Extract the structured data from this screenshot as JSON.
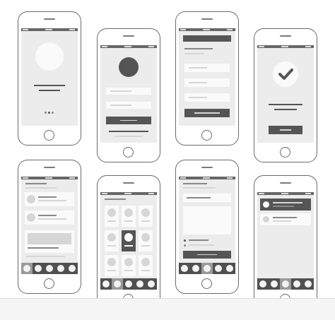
{
  "screens": [
    {
      "id": "splash",
      "description_label": ""
    },
    {
      "id": "login"
    },
    {
      "id": "form"
    },
    {
      "id": "success"
    },
    {
      "id": "feed"
    },
    {
      "id": "grid"
    },
    {
      "id": "compose"
    },
    {
      "id": "notifications"
    }
  ],
  "colors": {
    "frame": "#6a6a6a",
    "screen_bg": "#ececec",
    "dark_block": "#555555",
    "tabbar": "#505050"
  }
}
